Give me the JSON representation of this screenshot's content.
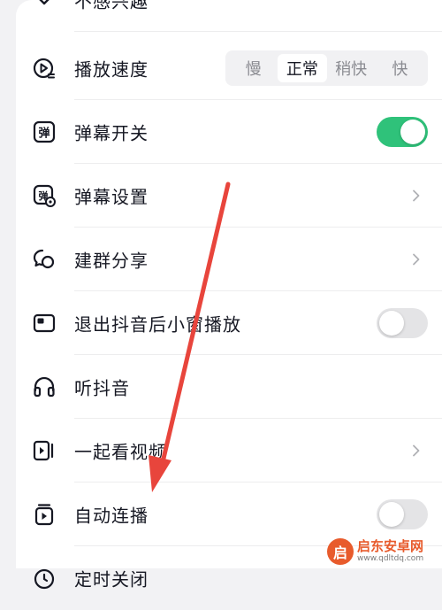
{
  "settings": {
    "items": [
      {
        "label": "不感兴趣"
      },
      {
        "label": "播放速度"
      },
      {
        "label": "弹幕开关"
      },
      {
        "label": "弹幕设置"
      },
      {
        "label": "建群分享"
      },
      {
        "label": "退出抖音后小窗播放"
      },
      {
        "label": "听抖音"
      },
      {
        "label": "一起看视频"
      },
      {
        "label": "自动连播"
      },
      {
        "label": "定时关闭"
      }
    ],
    "speed_options": [
      "慢",
      "正常",
      "稍快",
      "快"
    ],
    "speed_selected": "正常",
    "danmaku_toggle_on": true,
    "mini_window_toggle_on": false,
    "autoplay_toggle_on": false
  },
  "colors": {
    "toggle_on": "#2fc27a",
    "toggle_off": "#e4e4e6",
    "arrow": "#e8453c"
  },
  "watermark": {
    "badge": "启",
    "title": "启东安卓网",
    "url": "www.qdltdq.com"
  }
}
